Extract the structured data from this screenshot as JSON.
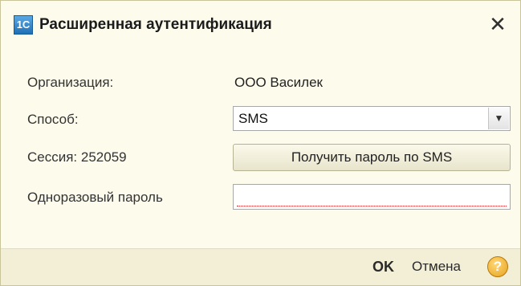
{
  "window": {
    "title": "Расширенная аутентификация",
    "app_icon_text": "1С",
    "close_symbol": "✕"
  },
  "form": {
    "organization_label": "Организация:",
    "organization_value": "ООО Василек",
    "method_label": "Способ:",
    "method_value": "SMS",
    "session_label": "Сессия: 252059",
    "get_password_button": "Получить пароль по SMS",
    "otp_label": "Одноразовый пароль",
    "otp_value": ""
  },
  "footer": {
    "ok_label": "OK",
    "cancel_label": "Отмена",
    "help_symbol": "?"
  },
  "icons": {
    "app": "1c-app-icon",
    "close": "close-icon",
    "dropdown": "chevron-down-icon",
    "help": "help-icon"
  },
  "colors": {
    "background": "#fdfbec",
    "footer_background": "#f2efd6",
    "required_underline": "#e02020",
    "help_icon": "#e8a21d"
  }
}
